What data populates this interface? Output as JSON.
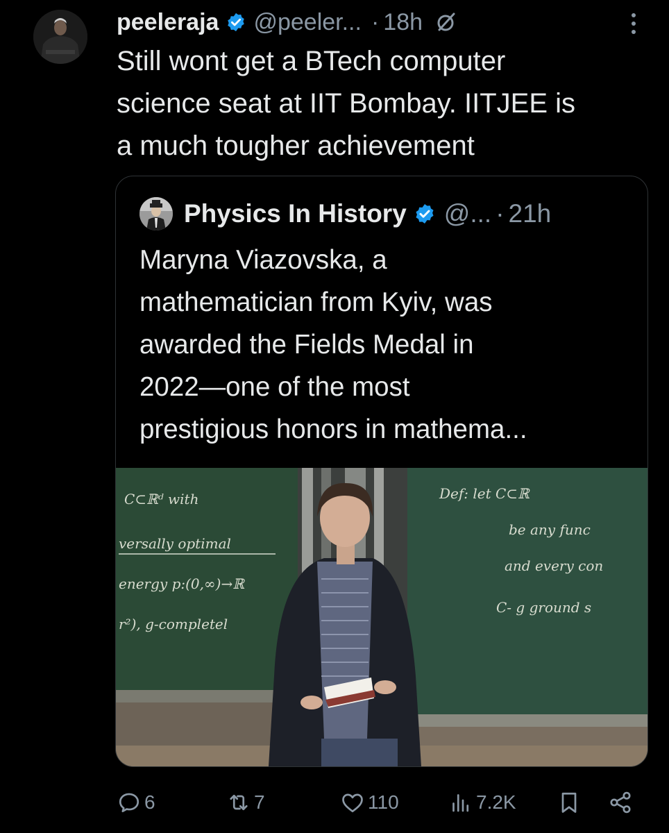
{
  "tweet": {
    "author_name": "peeleraja",
    "handle": "@peeler...",
    "dot": "·",
    "time": "18h",
    "text": "Still wont get a BTech computer\nscience seat at IIT Bombay. IITJEE is\na much tougher achievement"
  },
  "quoted": {
    "author_name": "Physics In History",
    "handle": "@...",
    "dot": "·",
    "time": "21h",
    "text": "Maryna Viazovska, a\nmathematician from Kyiv, was\nawarded the Fields Medal in\n2022—one of the most\nprestigious honors in mathema...",
    "board_left_lines": [
      "C⊂ℝᵈ with",
      "versally optimal",
      "energy p:(0,∞)→ℝ",
      "r²), g-completel"
    ],
    "board_right_lines": [
      "Def: let C⊂ℝ",
      "be any func",
      "and every con",
      "C- g ground s"
    ]
  },
  "actions": {
    "replies": "6",
    "reposts": "7",
    "likes": "110",
    "views": "7.2K"
  },
  "colors": {
    "background": "#000000",
    "text": "#e7e9ea",
    "muted": "#8b98a5",
    "verified": "#1d9bf0",
    "border": "#2f3336",
    "chalkboard": "#2b4a36"
  },
  "icons": [
    "verified-badge-icon",
    "grok-icon",
    "more-icon",
    "reply-icon",
    "repost-icon",
    "like-icon",
    "views-icon",
    "bookmark-icon",
    "share-icon"
  ]
}
